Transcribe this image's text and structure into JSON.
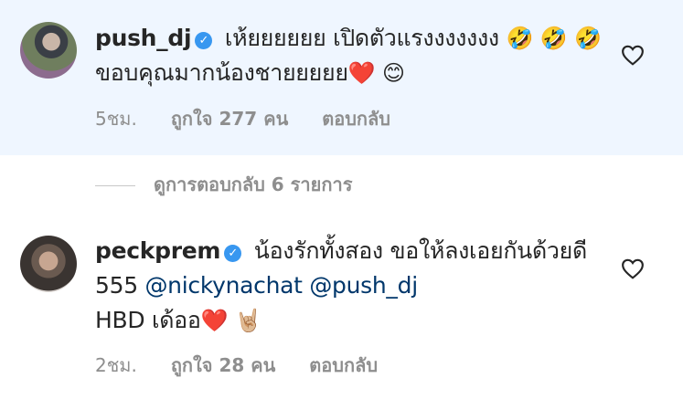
{
  "comments": [
    {
      "username": "push_dj",
      "verified_icon": "verified-badge-icon",
      "text_part1": "เห้ยยยยยย เปิดตัวแรงงงงงงง",
      "emoji_a": "🤣",
      "emoji_b": "🤣",
      "emoji_c": "🤣",
      "text_part2": "ขอบคุณมากน้องชายยยยย",
      "emoji_heart": "❤️",
      "emoji_smile": "😊",
      "time": "5ชม.",
      "likes": "ถูกใจ 277 คน",
      "reply": "ตอบกลับ"
    },
    {
      "username": "peckprem",
      "verified_icon": "verified-badge-icon",
      "text_part1": "น้องรักทั้งสอง ขอให้ลงเอยกันด้วยดี 555",
      "mention1": "@nickynachat",
      "mention2": "@push_dj",
      "text_part2": "HBD เด้ออ",
      "emoji_heart": "❤️",
      "emoji_rock": "🤘🏼",
      "time": "2ชม.",
      "likes": "ถูกใจ 28 คน",
      "reply": "ตอบกลับ"
    }
  ],
  "view_replies": "ดูการตอบกลับ 6 รายการ",
  "colors": {
    "highlight_bg": "#eff6ff",
    "verified": "#3897f0",
    "mention": "#00376b",
    "meta": "#8e8e8e"
  }
}
